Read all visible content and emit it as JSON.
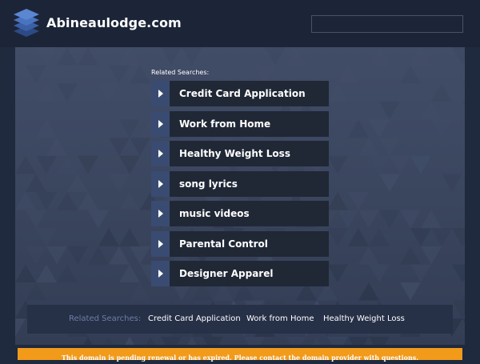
{
  "header": {
    "site_name": "Abineaulodge.com",
    "logo_icon": "stacked-layers-icon",
    "search": {
      "value": ""
    }
  },
  "related_searches": {
    "heading": "Related Searches:",
    "items": [
      {
        "label": "Credit Card Application"
      },
      {
        "label": "Work from Home"
      },
      {
        "label": "Healthy Weight Loss"
      },
      {
        "label": "song lyrics"
      },
      {
        "label": "music videos"
      },
      {
        "label": "Parental Control"
      },
      {
        "label": "Designer Apparel"
      }
    ],
    "arrow_icon": "play-arrow-icon"
  },
  "bottom_bar": {
    "heading": "Related Searches:",
    "links": [
      {
        "label": "Credit Card Application"
      },
      {
        "label": "Work from Home"
      },
      {
        "label": "Healthy Weight Loss"
      }
    ]
  },
  "notice": {
    "text": "This domain is pending renewal or has expired. Please contact the domain provider with questions."
  },
  "colors": {
    "header_bg": "#1c2538",
    "panel_bg": "#3b465f",
    "arrow_box": "#3a4b72",
    "label_box": "#202836",
    "notice_bg": "#f29a1a",
    "muted_text": "#6c7fa6"
  }
}
